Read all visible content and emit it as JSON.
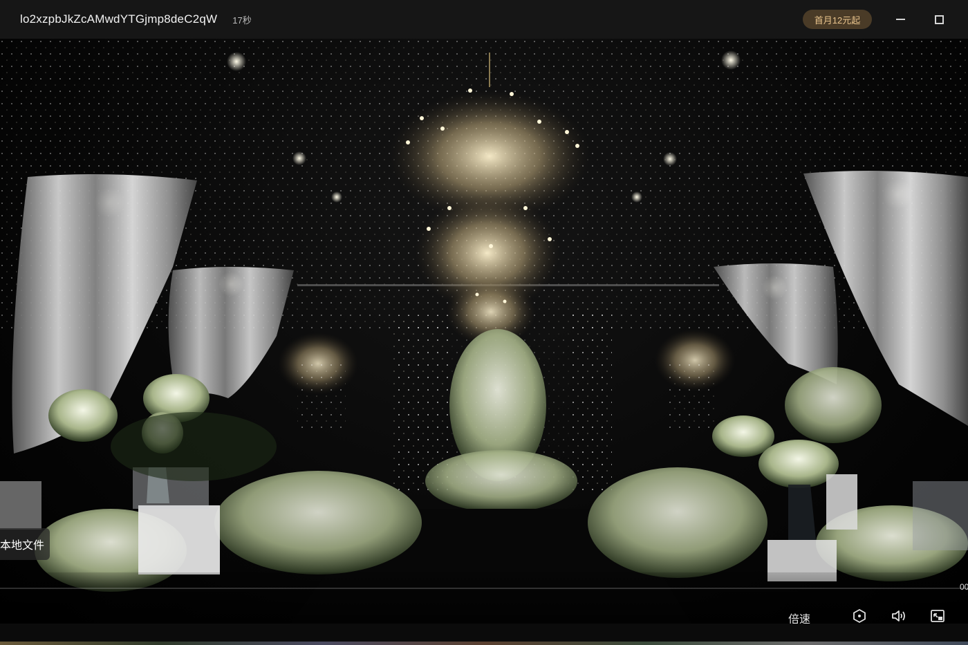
{
  "window": {
    "file_title": "lo2xzpbJkZcAMwdYTGjmp8deC2qW",
    "duration": "17秒",
    "promo_label": "首月12元起"
  },
  "video": {
    "description_icon": "video-frame",
    "overlay_local_file": "本地文件"
  },
  "controls": {
    "time_partial": "00",
    "speed_label": "倍速",
    "icons": [
      "hexagon-settings-icon",
      "volume-icon",
      "picture-in-picture-icon"
    ],
    "progress_fraction": 0.0
  },
  "colors": {
    "titlebar_bg": "#161616",
    "promo_bg": "#4a3b27",
    "promo_text": "#e9c48d"
  }
}
